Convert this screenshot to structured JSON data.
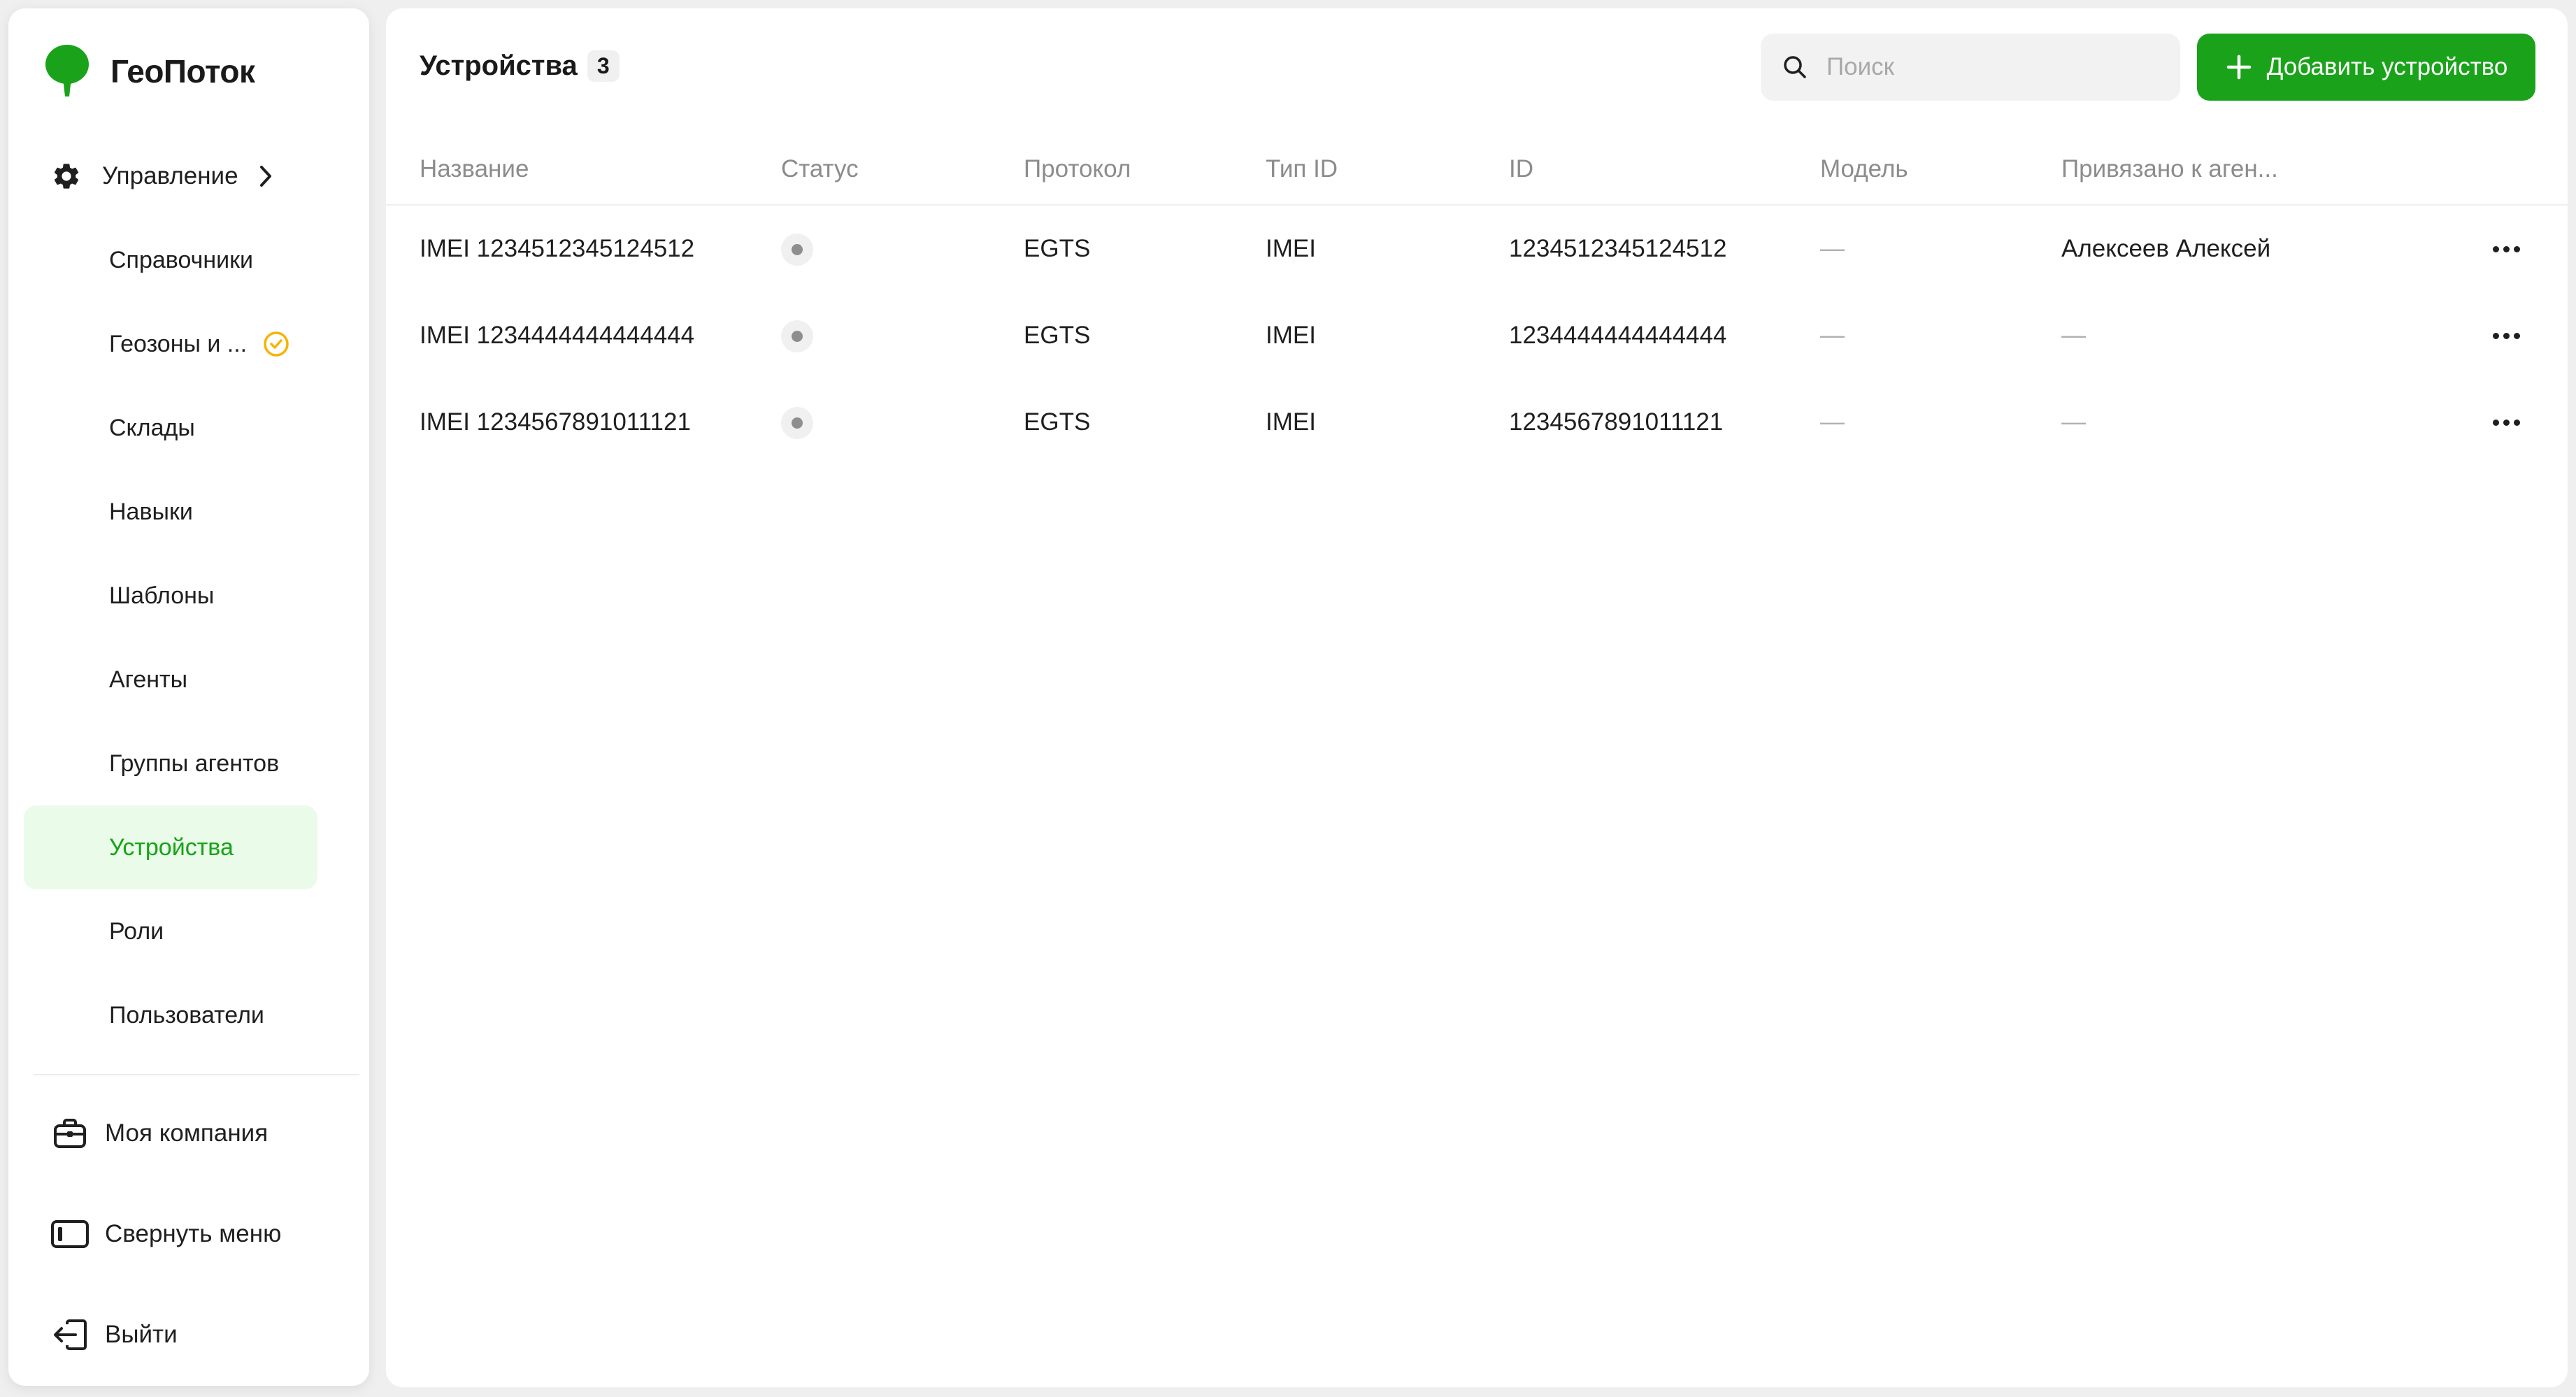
{
  "app": {
    "name": "ГеоПоток",
    "brand_color": "#1aa31a"
  },
  "sidebar": {
    "section": {
      "label": "Управление",
      "icon": "gear-icon"
    },
    "items": [
      {
        "label": "Справочники",
        "active": false
      },
      {
        "label": "Геозоны и ...",
        "active": false,
        "badge_icon": "clock-icon",
        "badge_color": "#f4b400"
      },
      {
        "label": "Склады",
        "active": false
      },
      {
        "label": "Навыки",
        "active": false
      },
      {
        "label": "Шаблоны",
        "active": false
      },
      {
        "label": "Агенты",
        "active": false
      },
      {
        "label": "Группы агентов",
        "active": false
      },
      {
        "label": "Устройства",
        "active": true
      },
      {
        "label": "Роли",
        "active": false
      },
      {
        "label": "Пользователи",
        "active": false
      }
    ],
    "bottom": {
      "company": {
        "label": "Моя компания",
        "icon": "briefcase-icon"
      },
      "collapse": {
        "label": "Свернуть меню",
        "icon": "sidebar-collapse-icon"
      },
      "logout": {
        "label": "Выйти",
        "icon": "logout-icon"
      }
    }
  },
  "header": {
    "title": "Устройства",
    "count": "3",
    "search": {
      "placeholder": "Поиск",
      "value": ""
    },
    "add_button": "Добавить устройство"
  },
  "table": {
    "columns": [
      "Название",
      "Статус",
      "Протокол",
      "Тип ID",
      "ID",
      "Модель",
      "Привязано к аген..."
    ],
    "rows": [
      {
        "name": "IMEI 1234512345124512",
        "status": "offline",
        "protocol": "EGTS",
        "id_type": "IMEI",
        "id": "1234512345124512",
        "model": "—",
        "agent": "Алексеев Алексей"
      },
      {
        "name": "IMEI 1234444444444444",
        "status": "offline",
        "protocol": "EGTS",
        "id_type": "IMEI",
        "id": "1234444444444444",
        "model": "—",
        "agent": "—"
      },
      {
        "name": "IMEI 1234567891011121",
        "status": "offline",
        "protocol": "EGTS",
        "id_type": "IMEI",
        "id": "1234567891011121",
        "model": "—",
        "agent": "—"
      }
    ]
  }
}
